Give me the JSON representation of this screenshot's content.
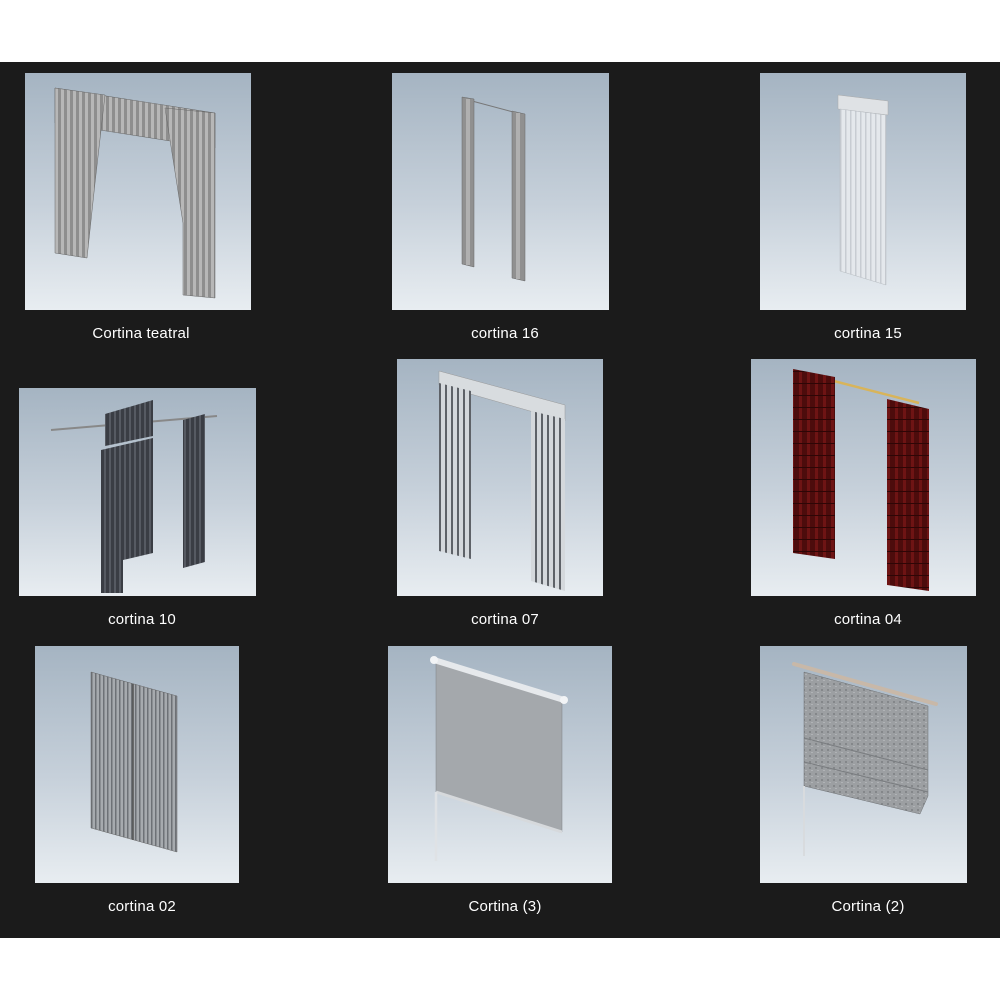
{
  "files": [
    {
      "name": "Cortina teatral",
      "thumbnail_icon": "theater-curtain-icon"
    },
    {
      "name": "cortina 16",
      "thumbnail_icon": "curtain-panels-icon"
    },
    {
      "name": "cortina 15",
      "thumbnail_icon": "sheer-curtain-icon"
    },
    {
      "name": "cortina 10",
      "thumbnail_icon": "dark-curtain-icon"
    },
    {
      "name": "cortina 07",
      "thumbnail_icon": "striped-curtain-icon"
    },
    {
      "name": "cortina 04",
      "thumbnail_icon": "red-curtain-icon"
    },
    {
      "name": "cortina 02",
      "thumbnail_icon": "pleated-curtain-icon"
    },
    {
      "name": "Cortina (3)",
      "thumbnail_icon": "roller-blind-icon"
    },
    {
      "name": "Cortina (2)",
      "thumbnail_icon": "roman-shade-icon"
    }
  ],
  "colors": {
    "background": "#1b1b1b",
    "label_text": "#ffffff",
    "curtain_red": "#5a0f0f"
  }
}
